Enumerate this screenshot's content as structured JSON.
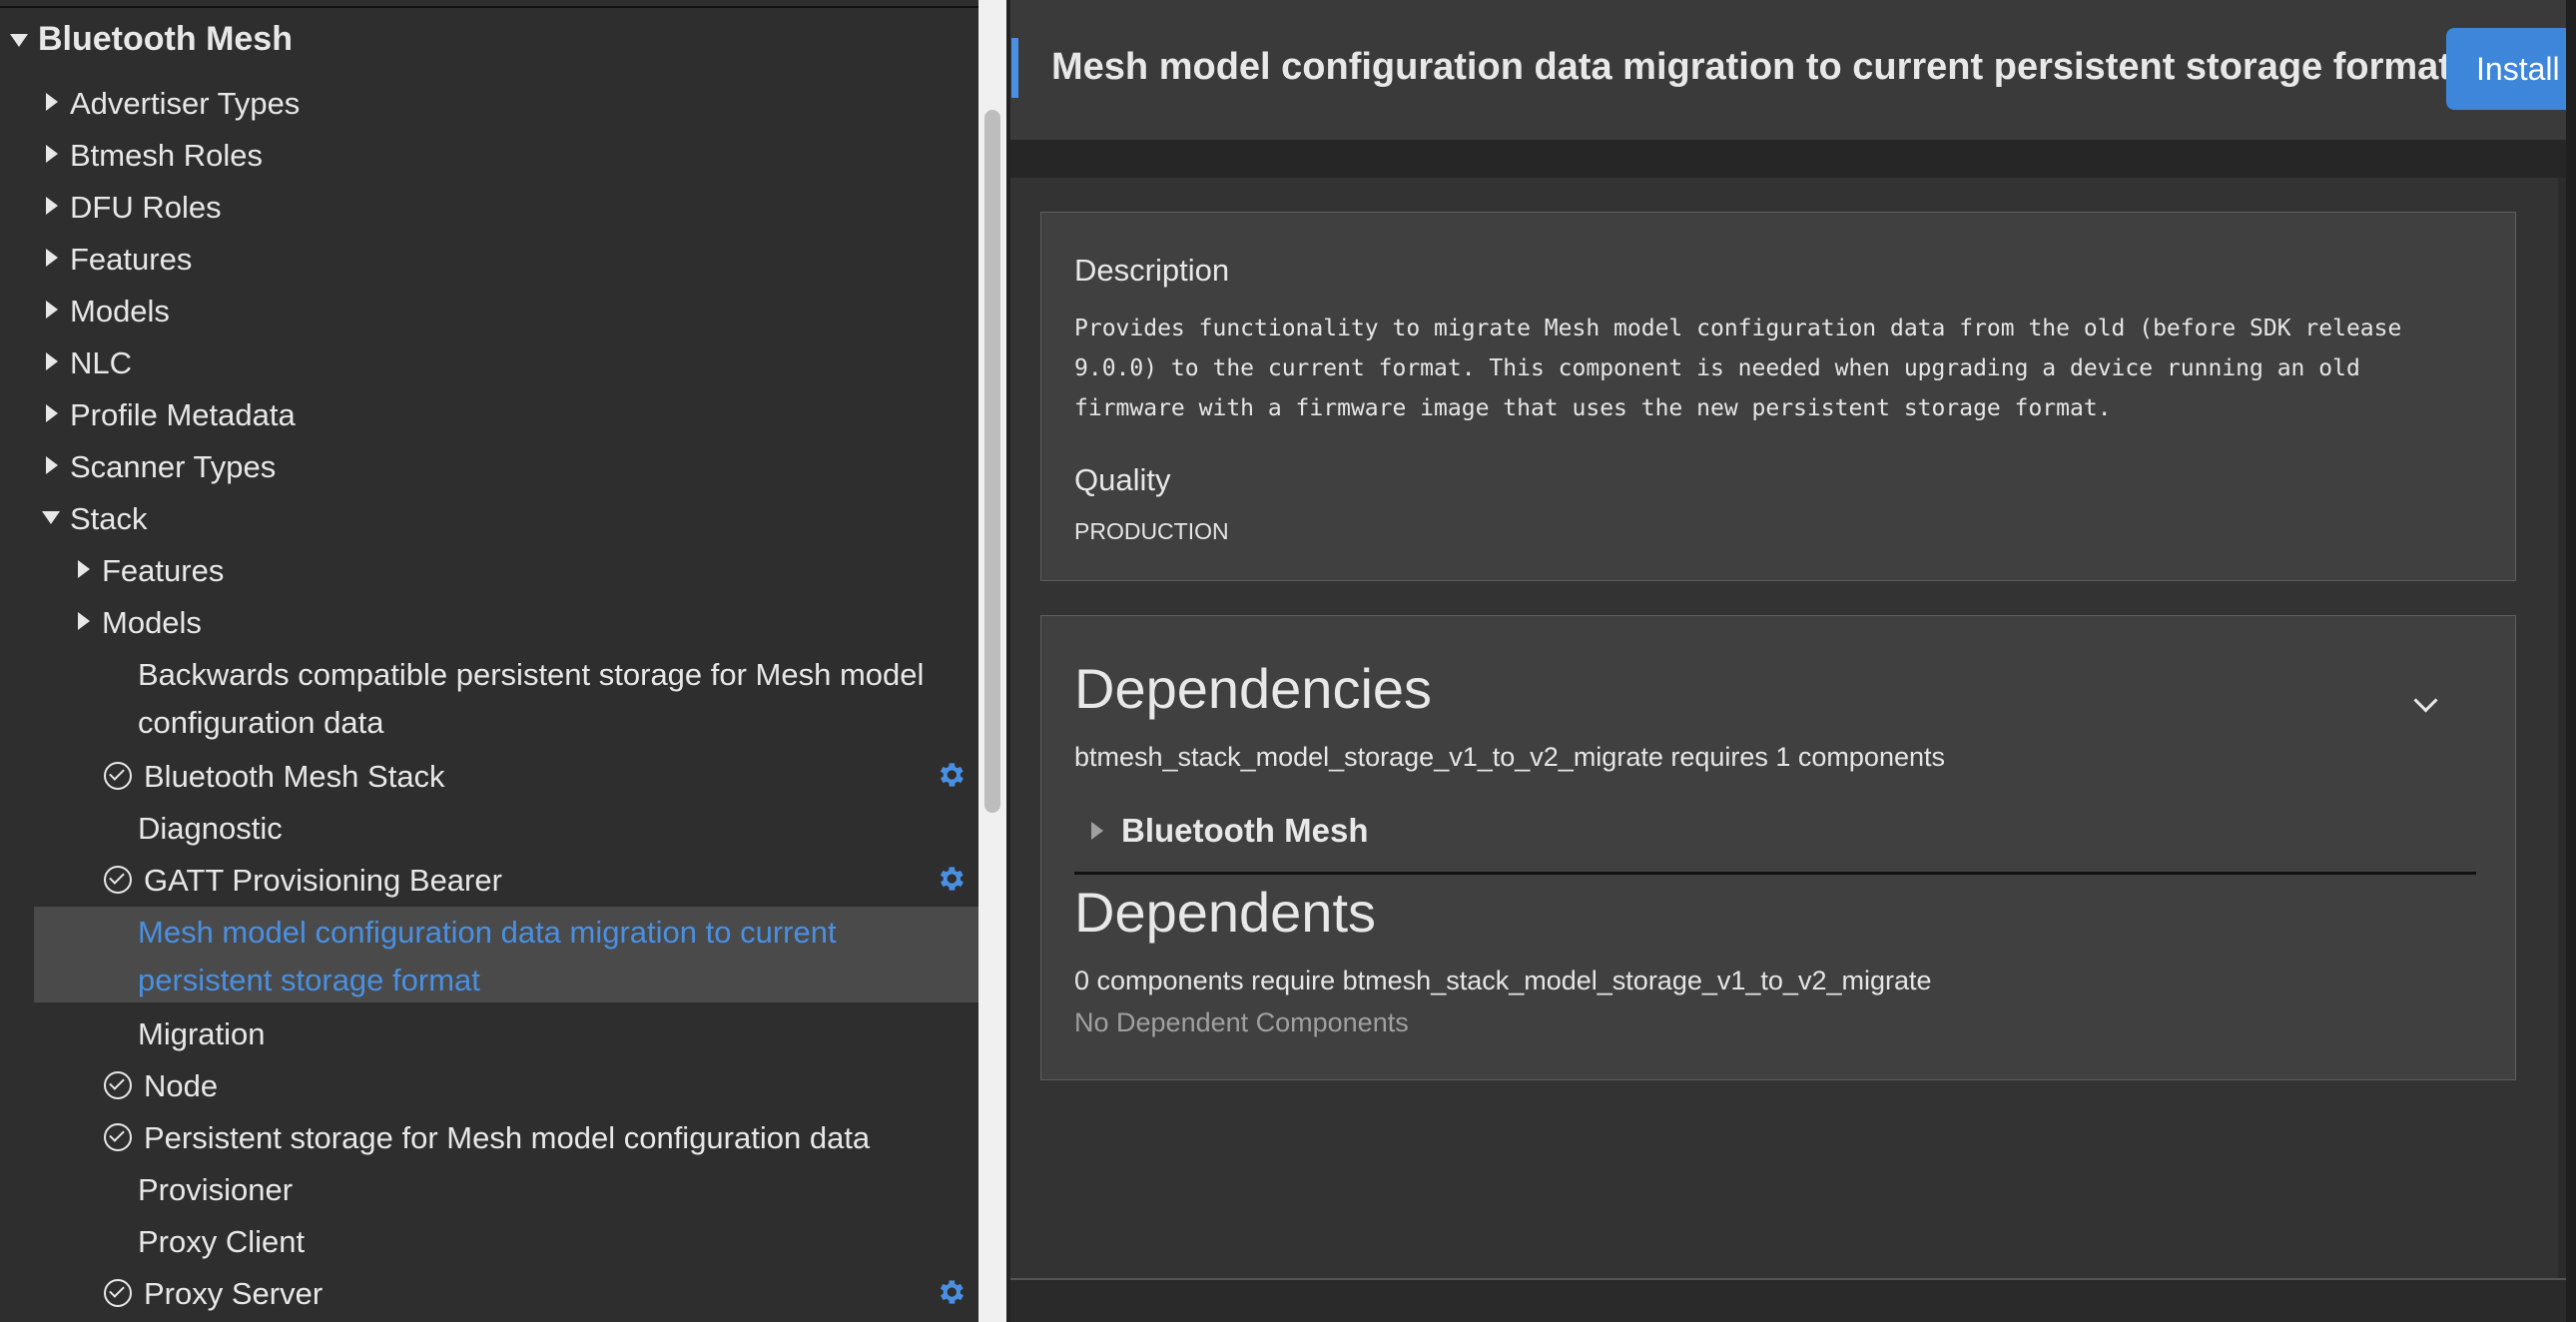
{
  "tree": {
    "root": "Bluetooth Mesh",
    "top_items": [
      "Advertiser Types",
      "Btmesh Roles",
      "DFU Roles",
      "Features",
      "Models",
      "NLC",
      "Profile Metadata",
      "Scanner Types"
    ],
    "stack": {
      "label": "Stack",
      "groups": [
        "Features",
        "Models"
      ],
      "components": [
        {
          "label": "Backwards compatible persistent storage for Mesh model",
          "label2": "configuration data",
          "installed": false,
          "configurable": false
        },
        {
          "label": "Bluetooth Mesh Stack",
          "installed": true,
          "configurable": true
        },
        {
          "label": "Diagnostic",
          "installed": false,
          "configurable": false
        },
        {
          "label": "GATT Provisioning Bearer",
          "installed": true,
          "configurable": true
        },
        {
          "label": "Mesh model configuration data migration to current",
          "label2": "persistent storage format",
          "installed": false,
          "configurable": false,
          "selected": true
        },
        {
          "label": "Migration",
          "installed": false,
          "configurable": false
        },
        {
          "label": "Node",
          "installed": true,
          "configurable": false
        },
        {
          "label": "Persistent storage for Mesh model configuration data",
          "installed": true,
          "configurable": false
        },
        {
          "label": "Provisioner",
          "installed": false,
          "configurable": false
        },
        {
          "label": "Proxy Client",
          "installed": false,
          "configurable": false
        },
        {
          "label": "Proxy Server",
          "installed": true,
          "configurable": true
        }
      ]
    }
  },
  "detail": {
    "title": "Mesh model configuration data migration to current persistent storage format",
    "install_label": "Install",
    "description": {
      "heading": "Description",
      "lines": [
        "Provides functionality to migrate Mesh model configuration data from the old (before SDK release",
        "9.0.0) to the current format. This component is needed when upgrading a device running an old",
        "firmware with a firmware image that uses the new persistent storage format."
      ]
    },
    "quality": {
      "heading": "Quality",
      "value": "PRODUCTION"
    },
    "dependencies": {
      "heading": "Dependencies",
      "summary": "btmesh_stack_model_storage_v1_to_v2_migrate requires 1 components",
      "item": "Bluetooth Mesh"
    },
    "dependents": {
      "heading": "Dependents",
      "summary": "0 components require btmesh_stack_model_storage_v1_to_v2_migrate",
      "empty": "No Dependent Components"
    }
  },
  "colors": {
    "accent": "#4a90e2",
    "install_button": "#3d86d9"
  },
  "icons": {
    "installed": "check-circle-icon",
    "configure": "gear-icon",
    "expanded": "triangle-down-icon",
    "collapsed": "triangle-right-icon"
  }
}
